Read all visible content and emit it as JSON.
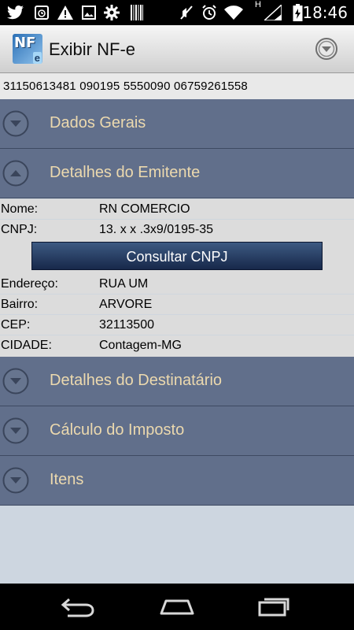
{
  "status": {
    "time": "18:46",
    "icons": [
      "twitter-icon",
      "alarm-clock-icon",
      "warning-icon",
      "image-icon",
      "settings-gear-icon",
      "barcode-icon",
      "mute-icon",
      "alarm-icon",
      "wifi-icon",
      "signal-icon",
      "battery-icon"
    ],
    "signal_label": "H"
  },
  "header": {
    "title": "Exibir NF-e",
    "logo_main": "NF",
    "logo_sub": "e"
  },
  "access_key": "31150613481  090195  5550090  06759261558",
  "sections": [
    {
      "label": "Dados Gerais"
    },
    {
      "label": "Detalhes do Emitente"
    },
    {
      "label": "Detalhes do Destinatário"
    },
    {
      "label": "Cálculo do Imposto"
    },
    {
      "label": "Itens"
    }
  ],
  "emitente": {
    "nome_label": "Nome:",
    "nome_value": "RN COMERCIO",
    "cnpj_label": "CNPJ:",
    "cnpj_value": "13. x x .3x9/0195-35",
    "consult_button": "Consultar CNPJ",
    "endereco_label": "Endereço:",
    "endereco_value": "RUA UM",
    "bairro_label": "Bairro:",
    "bairro_value": "ARVORE",
    "cep_label": "CEP:",
    "cep_value": "32113500",
    "cidade_label": "CIDADE:",
    "cidade_value": "Contagem-MG"
  },
  "colors": {
    "section_bg": "#616f8b",
    "section_text": "#ecd9ae",
    "detail_bg": "#dcdcdc",
    "button_bg": "#1f3357"
  }
}
